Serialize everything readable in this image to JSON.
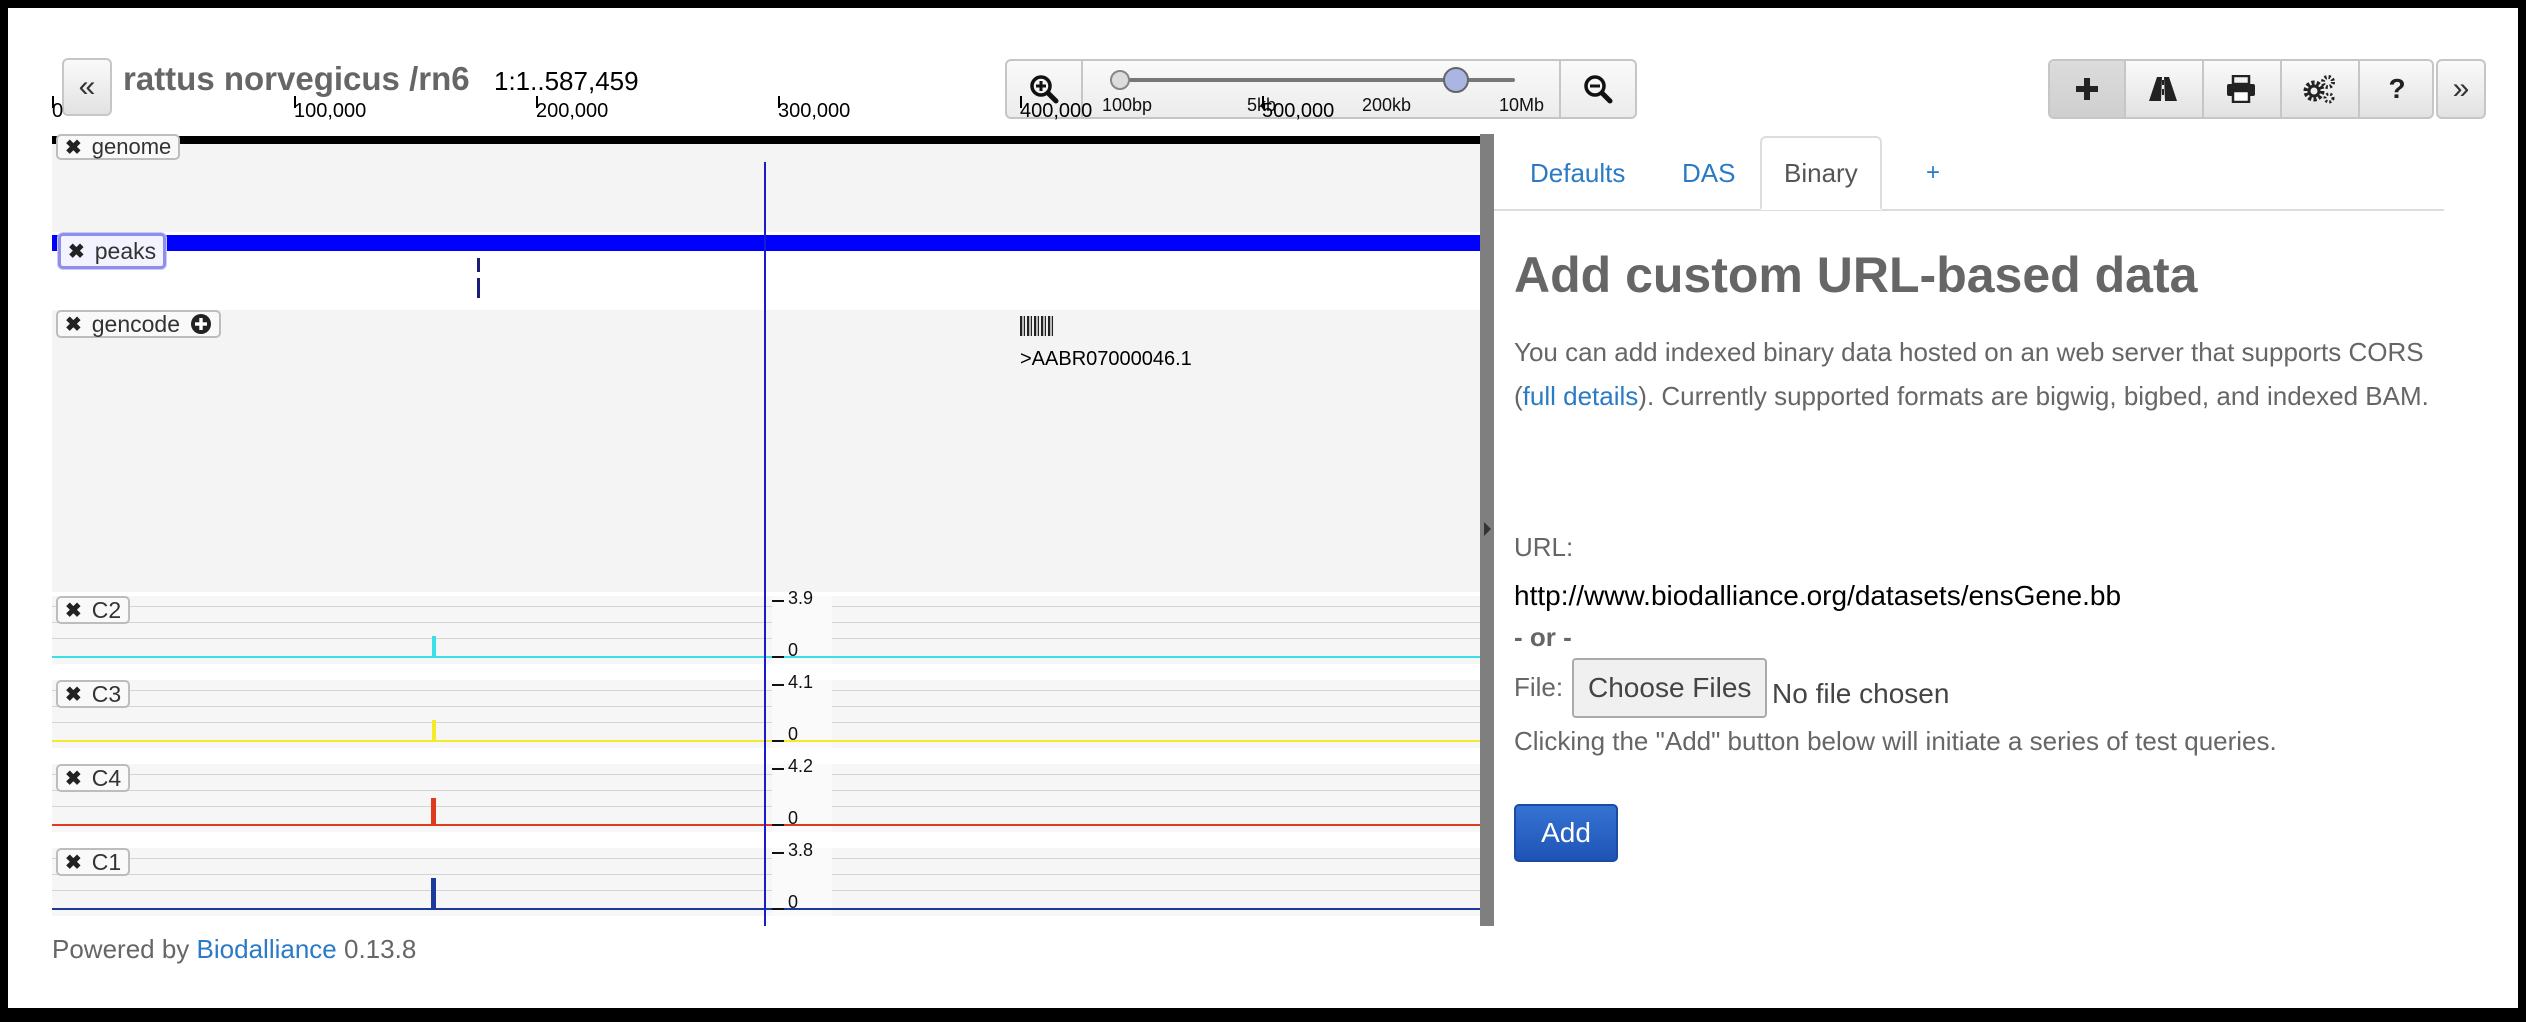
{
  "header": {
    "collapse_left_glyph": "«",
    "species_title": "rattus norvegicus /rn6",
    "location": "1:1..587,459",
    "zoom_labels": [
      "100bp",
      "5kb",
      "200kb",
      "10Mb"
    ],
    "zoom_level": 0.85,
    "expand_right_glyph": "»",
    "toolbar_icons": [
      "add-track-icon",
      "road-icon",
      "print-icon",
      "settings-icon",
      "help-icon"
    ],
    "toolbar_help_glyph": "?"
  },
  "ruler": {
    "labels": [
      "100,000",
      "200,000",
      "300,000",
      "400,000",
      "500,000"
    ],
    "start_glyph": "0"
  },
  "tracks": {
    "genome": {
      "label": "genome"
    },
    "peaks": {
      "label": "peaks"
    },
    "gencode": {
      "label": "gencode",
      "feature_label": ">AABR07000046.1"
    },
    "signals": [
      {
        "label": "C2",
        "max": "3.9",
        "min": "0",
        "color": "#39e0e8"
      },
      {
        "label": "C3",
        "max": "4.1",
        "min": "0",
        "color": "#f3ea2a"
      },
      {
        "label": "C4",
        "max": "4.2",
        "min": "0",
        "color": "#e03a1e"
      },
      {
        "label": "C1",
        "max": "3.8",
        "min": "0",
        "color": "#1b3a9c"
      }
    ]
  },
  "colors": {
    "accent_blue": "#2a7ac6",
    "peaks_bar": "#0000ff",
    "add_button": "#2057b8"
  },
  "footer": {
    "powered_by": "Powered by",
    "link": "Biodalliance",
    "version": "0.13.8"
  },
  "panel": {
    "tabs": [
      "Defaults",
      "DAS",
      "Binary",
      "+"
    ],
    "active_tab": "Binary",
    "heading": "Add custom URL-based data",
    "desc_part1": "You can add indexed binary data hosted on an web server that supports CORS (",
    "desc_link": "full details",
    "desc_part2": "). Currently supported formats are bigwig, bigbed, and indexed BAM.",
    "url_label": "URL:",
    "url_value": "http://www.biodalliance.org/datasets/ensGene.bb",
    "or_label": "- or -",
    "file_label": "File:",
    "choose_files": "Choose Files",
    "no_file": "No file chosen",
    "hint": "Clicking the \"Add\" button below will initiate a series of test queries.",
    "add_button": "Add"
  }
}
